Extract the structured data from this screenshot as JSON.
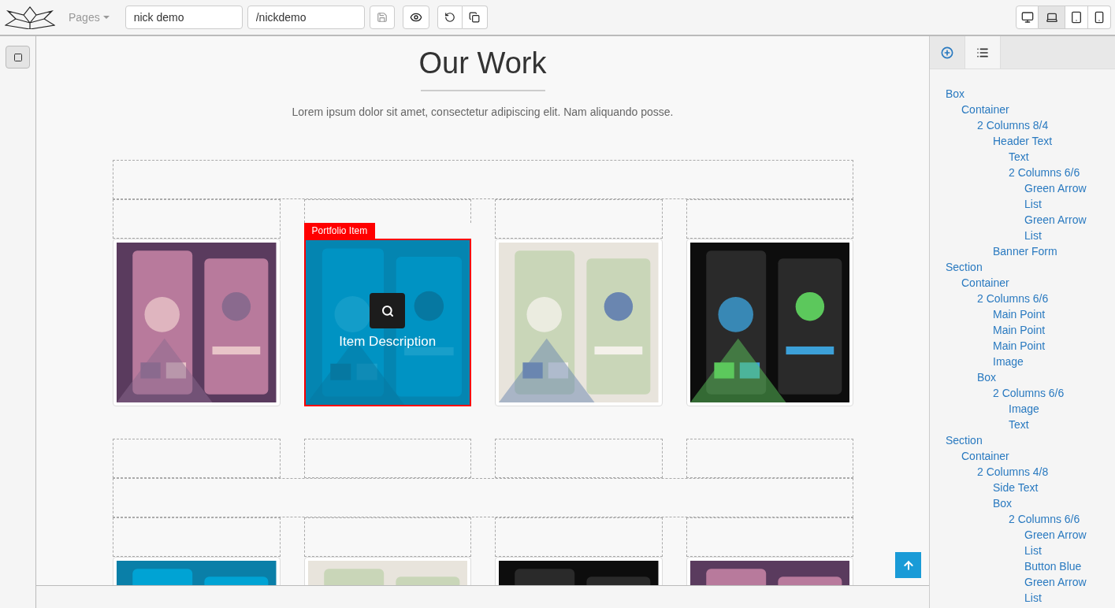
{
  "toolbar": {
    "pages_menu": "Pages",
    "page_name": "nick demo",
    "page_url": "/nickdemo",
    "devices": [
      {
        "kind": "desktop",
        "selected": false
      },
      {
        "kind": "laptop",
        "selected": true
      },
      {
        "kind": "tablet",
        "selected": false
      },
      {
        "kind": "phone",
        "selected": false
      }
    ]
  },
  "canvas": {
    "heading": "Our Work",
    "intro": "Lorem ipsum dolor sit amet, consectetur adipiscing elit. Nam aliquando posse.",
    "portfolio_rows": [
      {
        "items": [
          {
            "selected": false
          },
          {
            "selected": true,
            "badge": "Portfolio Item",
            "description": "Item Description"
          },
          {
            "selected": false
          },
          {
            "selected": false
          }
        ]
      },
      {
        "items": [
          {
            "selected": false
          },
          {
            "selected": false
          },
          {
            "selected": false
          },
          {
            "selected": false
          }
        ]
      }
    ]
  },
  "panel": {
    "tabs": [
      {
        "kind": "add",
        "selected": false
      },
      {
        "kind": "list",
        "selected": true
      }
    ],
    "tree": [
      {
        "label": "Box",
        "children": [
          {
            "label": "Container",
            "children": [
              {
                "label": "2 Columns 8/4",
                "children": [
                  {
                    "label": "Header Text",
                    "children": [
                      {
                        "label": "Text"
                      },
                      {
                        "label": "2 Columns 6/6",
                        "children": [
                          {
                            "label": "Green Arrow"
                          },
                          {
                            "label": "List"
                          },
                          {
                            "label": "Green Arrow"
                          },
                          {
                            "label": "List"
                          }
                        ]
                      }
                    ]
                  },
                  {
                    "label": "Banner Form"
                  }
                ]
              }
            ]
          }
        ]
      },
      {
        "label": "Section",
        "children": [
          {
            "label": "Container",
            "children": [
              {
                "label": "2 Columns 6/6",
                "children": [
                  {
                    "label": "Main Point"
                  },
                  {
                    "label": "Main Point"
                  },
                  {
                    "label": "Main Point"
                  },
                  {
                    "label": "Image"
                  }
                ]
              },
              {
                "label": "Box",
                "children": [
                  {
                    "label": "2 Columns 6/6",
                    "children": [
                      {
                        "label": "Image"
                      },
                      {
                        "label": "Text"
                      }
                    ]
                  }
                ]
              }
            ]
          }
        ]
      },
      {
        "label": "Section",
        "children": [
          {
            "label": "Container",
            "children": [
              {
                "label": "2 Columns 4/8",
                "children": [
                  {
                    "label": "Side Text"
                  },
                  {
                    "label": "Box",
                    "children": [
                      {
                        "label": "2 Columns 6/6",
                        "children": [
                          {
                            "label": "Green Arrow"
                          },
                          {
                            "label": "List"
                          },
                          {
                            "label": "Button Blue"
                          },
                          {
                            "label": "Green Arrow"
                          },
                          {
                            "label": "List"
                          }
                        ]
                      }
                    ]
                  }
                ]
              }
            ]
          }
        ]
      }
    ]
  }
}
